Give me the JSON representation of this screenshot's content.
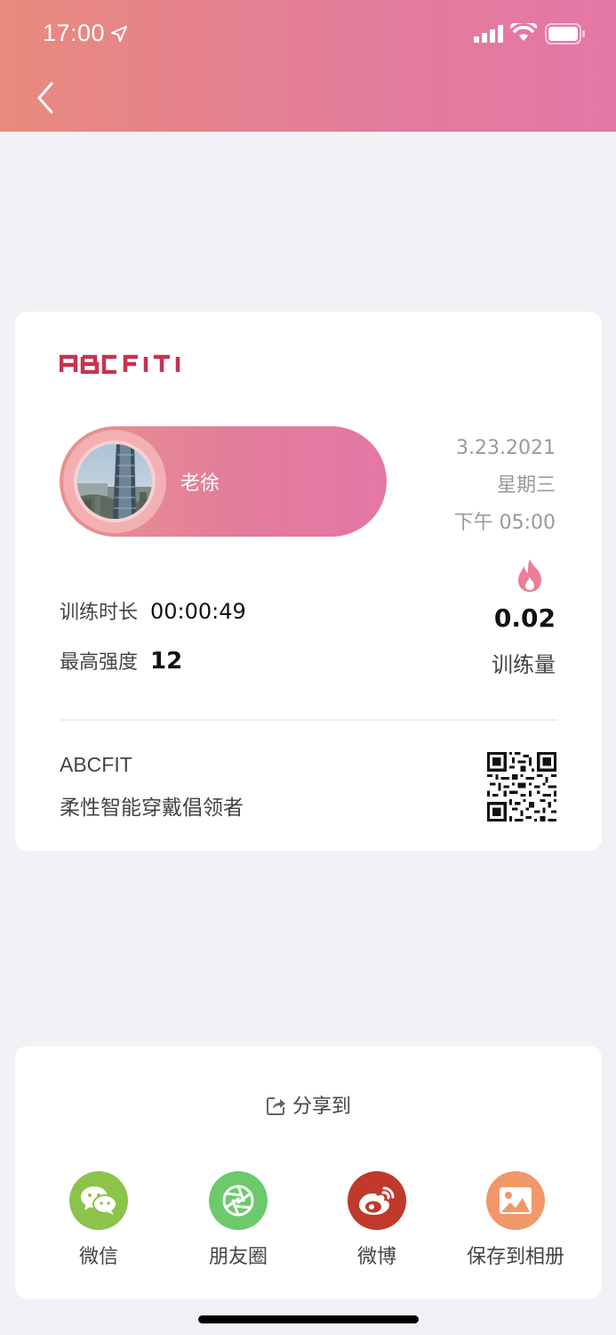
{
  "status_bar": {
    "time": "17:00"
  },
  "card": {
    "logo_text": "ABCFIT",
    "user_name": "老徐",
    "date": "3.23.2021",
    "weekday": "星期三",
    "time": "下午 05:00",
    "stats": [
      {
        "label": "训练时长",
        "value": "00:00:49"
      },
      {
        "label": "最高强度",
        "value": "12"
      }
    ],
    "training_volume": {
      "value": "0.02",
      "label": "训练量"
    },
    "brand": "ABCFIT",
    "slogan": "柔性智能穿戴倡领者"
  },
  "share": {
    "title": "分享到",
    "options": [
      {
        "label": "微信",
        "icon": "wechat-icon",
        "color": "#8cc34b"
      },
      {
        "label": "朋友圈",
        "icon": "moments-icon",
        "color": "#6cc96c"
      },
      {
        "label": "微博",
        "icon": "weibo-icon",
        "color": "#c0392b"
      },
      {
        "label": "保存到相册",
        "icon": "album-icon",
        "color": "#f0986a"
      }
    ]
  },
  "colors": {
    "accent_start": "#e98a7d",
    "accent_end": "#e577a6",
    "logo": "#c8334f"
  }
}
